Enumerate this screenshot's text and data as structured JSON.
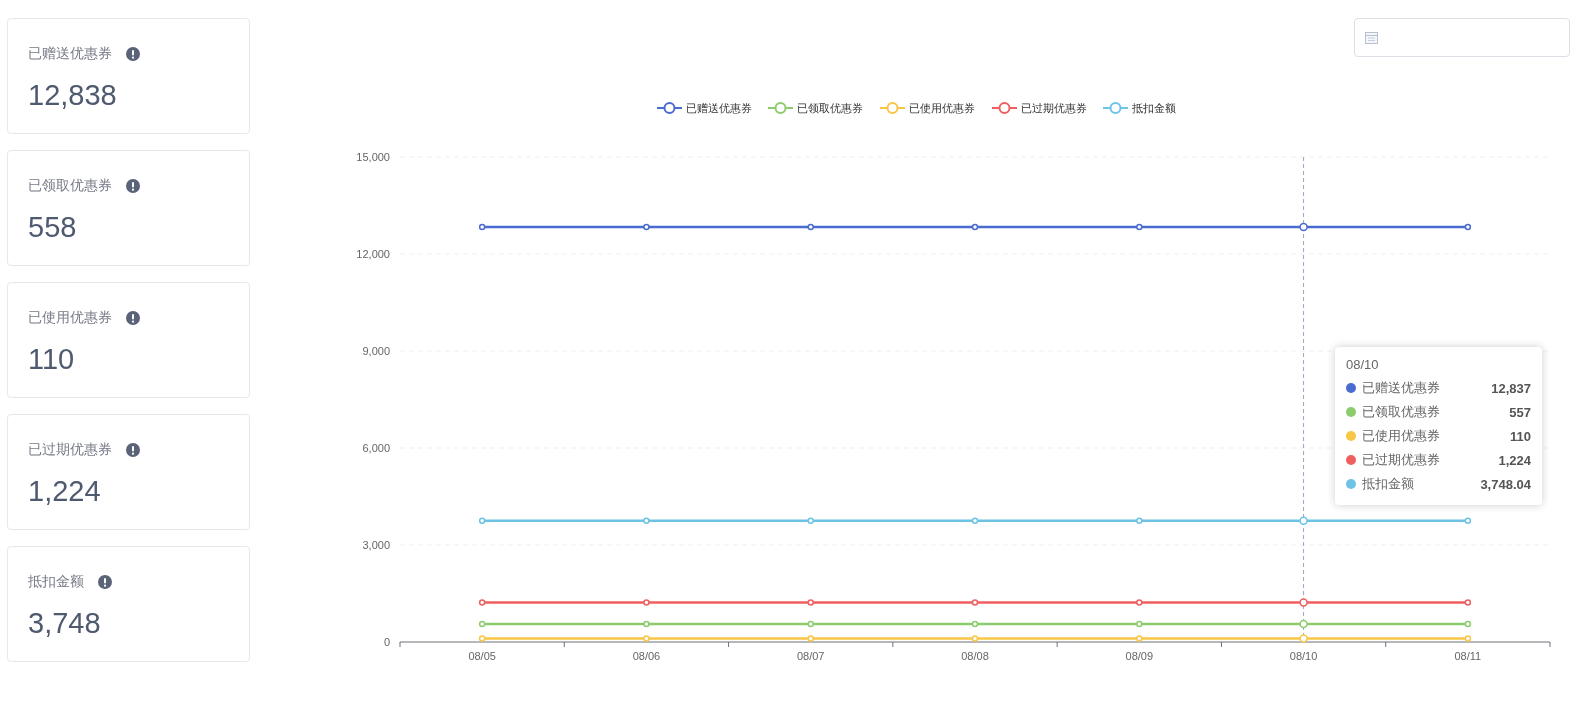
{
  "cards": [
    {
      "label": "已赠送优惠券",
      "value": "12,838"
    },
    {
      "label": "已领取优惠券",
      "value": "558"
    },
    {
      "label": "已使用优惠券",
      "value": "110"
    },
    {
      "label": "已过期优惠券",
      "value": "1,224"
    },
    {
      "label": "抵扣金额",
      "value": "3,748"
    }
  ],
  "chart": {
    "chart_data": {
      "type": "line",
      "grid": true,
      "legend": true,
      "ref_lines": [
        {
          "axis": "x",
          "value": "08/10"
        }
      ],
      "categories": [
        "08/05",
        "08/06",
        "08/07",
        "08/08",
        "08/09",
        "08/10",
        "08/11"
      ],
      "ylim": [
        0,
        15000
      ],
      "yticks": [
        {
          "value": 0,
          "label": "0"
        },
        {
          "value": 3000,
          "label": "3,000"
        },
        {
          "value": 6000,
          "label": "6,000"
        },
        {
          "value": 9000,
          "label": "9,000"
        },
        {
          "value": 12000,
          "label": "12,000"
        },
        {
          "value": 15000,
          "label": "15,000"
        }
      ],
      "series": [
        {
          "name": "已赠送优惠券",
          "color": "#4a6bd0",
          "marker": "circle",
          "values": [
            12837,
            12837,
            12837,
            12837,
            12837,
            12837,
            12837
          ]
        },
        {
          "name": "已领取优惠券",
          "color": "#8ccc6c",
          "marker": "circle",
          "values": [
            557,
            557,
            557,
            557,
            557,
            557,
            557
          ]
        },
        {
          "name": "已使用优惠券",
          "color": "#f9c646",
          "marker": "circle",
          "values": [
            110,
            110,
            110,
            110,
            110,
            110,
            110
          ]
        },
        {
          "name": "已过期优惠券",
          "color": "#ef5f5f",
          "marker": "circle",
          "values": [
            1224,
            1224,
            1224,
            1224,
            1224,
            1224,
            1224
          ]
        },
        {
          "name": "抵扣金额",
          "color": "#6cc3e6",
          "marker": "circle",
          "values": [
            3748.04,
            3748.04,
            3748.04,
            3748.04,
            3748.04,
            3748.04,
            3748.04
          ]
        }
      ]
    },
    "tooltip": {
      "title": "08/10",
      "rows": [
        {
          "name": "已赠送优惠券",
          "value": "12,837",
          "color": "#4a6bd0"
        },
        {
          "name": "已领取优惠券",
          "value": "557",
          "color": "#8ccc6c"
        },
        {
          "name": "已使用优惠券",
          "value": "110",
          "color": "#f9c646"
        },
        {
          "name": "已过期优惠券",
          "value": "1,224",
          "color": "#ef5f5f"
        },
        {
          "name": "抵扣金额",
          "value": "3,748.04",
          "color": "#6cc3e6"
        }
      ]
    }
  }
}
